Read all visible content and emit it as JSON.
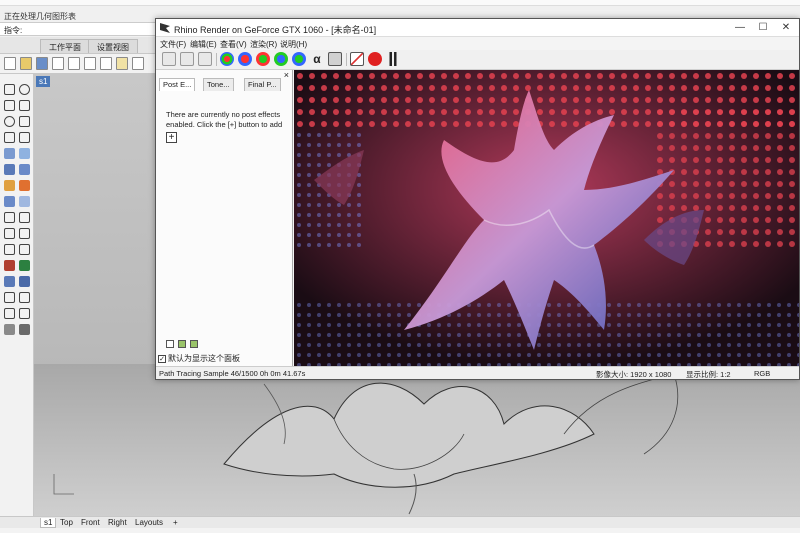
{
  "rhino": {
    "command_history": "正在处理几何图形表",
    "command_prompt": "指令:",
    "ribbon_tabs": [
      "工作平面",
      "设置视图"
    ],
    "viewport_label": "s1",
    "viewport_tabs": [
      "s1",
      "Top",
      "Front",
      "Right",
      "Layouts"
    ],
    "add_tab": "+"
  },
  "render_window": {
    "title": "Rhino Render on GeForce GTX 1060 - [未命名-01]",
    "menu": [
      "文件(F)",
      "编辑(E)",
      "查看(V)",
      "渲染(R)",
      "说明(H)"
    ],
    "panel_tabs": [
      "Post E...",
      "Tone...",
      "Final P..."
    ],
    "panel_close": "×",
    "panel_message": "There are currently no post effects enabled. Click the [+] button to add",
    "add_button": "+",
    "checkbox_label": "默认为显示这个面板",
    "status": {
      "progress": "Path Tracing Sample 46/1500 0h 0m 41.67s",
      "image_size": "影像大小: 1920 x 1080",
      "display_ratio": "显示比例: 1:2",
      "color_mode": "RGB"
    },
    "window_buttons": {
      "minimize": "—",
      "maximize": "☐",
      "close": "✕"
    }
  },
  "colors": {
    "accent": "#4a78b8",
    "render_red": "#d8243c",
    "render_blue": "#6a7cf0"
  }
}
